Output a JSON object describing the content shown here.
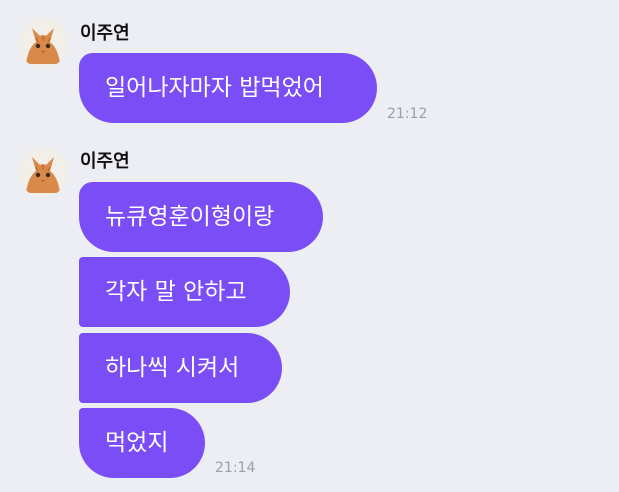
{
  "messages_groups": [
    {
      "sender": "이주연",
      "avatar_icon": "cat-photo-icon",
      "bubbles": [
        "일어나자마자 밥먹었어"
      ],
      "time": "21:12"
    },
    {
      "sender": "이주연",
      "avatar_icon": "cat-photo-icon",
      "bubbles": [
        "뉴큐영훈이형이랑",
        "각자 말 안하고",
        "하나씩 시켜서",
        "먹었지"
      ],
      "time": "21:14"
    }
  ],
  "colors": {
    "background": "#eceef3",
    "bubble": "#7b4df7",
    "bubble_text": "#ffffff",
    "time_text": "#9aa0a8"
  }
}
